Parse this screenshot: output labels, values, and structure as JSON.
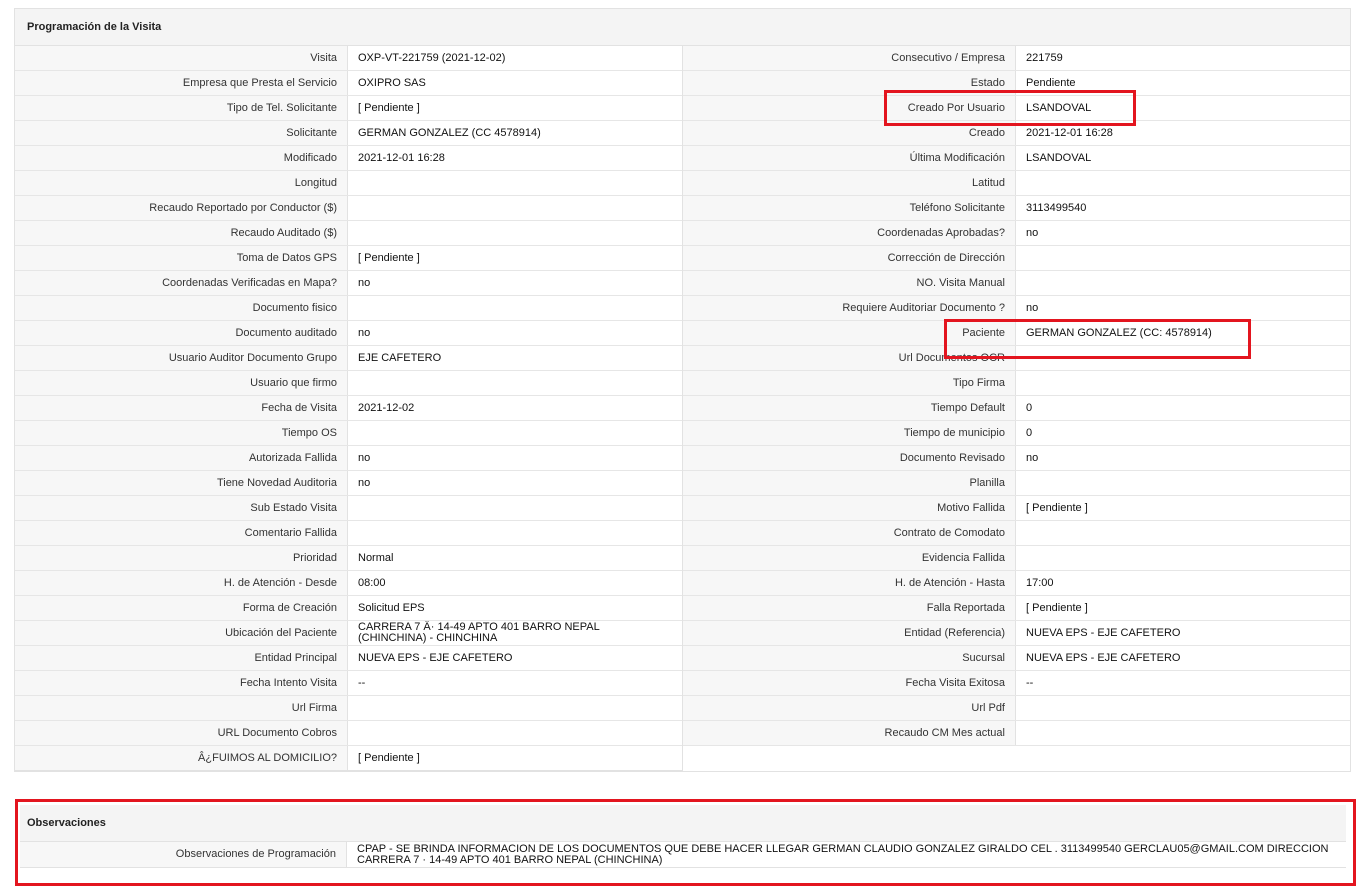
{
  "section_title": "Programación de la Visita",
  "left_rows": [
    {
      "label": "Visita",
      "value": "OXP-VT-221759 (2021-12-02)"
    },
    {
      "label": "Empresa que Presta el Servicio",
      "value": "OXIPRO SAS"
    },
    {
      "label": "Tipo de Tel. Solicitante",
      "value": "[ Pendiente ]"
    },
    {
      "label": "Solicitante",
      "value": "GERMAN GONZALEZ (CC 4578914)"
    },
    {
      "label": "Modificado",
      "value": "2021-12-01 16:28"
    },
    {
      "label": "Longitud",
      "value": ""
    },
    {
      "label": "Recaudo Reportado por Conductor ($)",
      "value": ""
    },
    {
      "label": "Recaudo Auditado ($)",
      "value": ""
    },
    {
      "label": "Toma de Datos GPS",
      "value": "[ Pendiente ]"
    },
    {
      "label": "Coordenadas Verificadas en Mapa?",
      "value": " no"
    },
    {
      "label": "Documento fisico",
      "value": ""
    },
    {
      "label": "Documento auditado",
      "value": " no"
    },
    {
      "label": "Usuario Auditor Documento Grupo",
      "value": "EJE CAFETERO"
    },
    {
      "label": "Usuario que firmo",
      "value": ""
    },
    {
      "label": "Fecha de Visita",
      "value": " 2021-12-02"
    },
    {
      "label": "Tiempo OS",
      "value": ""
    },
    {
      "label": "Autorizada Fallida",
      "value": " no"
    },
    {
      "label": "Tiene Novedad Auditoria",
      "value": " no"
    },
    {
      "label": "Sub Estado Visita",
      "value": ""
    },
    {
      "label": "Comentario Fallida",
      "value": ""
    },
    {
      "label": "Prioridad",
      "value": "Normal"
    },
    {
      "label": "H. de Atención - Desde",
      "value": "08:00"
    },
    {
      "label": "Forma de Creación",
      "value": "Solicitud EPS"
    },
    {
      "label": "Ubicación del Paciente",
      "value": "CARRERA 7 Â· 14-49 APTO 401 BARRO NEPAL (CHINCHINA) - CHINCHINA"
    },
    {
      "label": "Entidad Principal",
      "value": "NUEVA EPS - EJE CAFETERO"
    },
    {
      "label": "Fecha Intento Visita",
      "value": " --"
    },
    {
      "label": "Url Firma",
      "value": ""
    },
    {
      "label": "URL Documento Cobros",
      "value": ""
    },
    {
      "label": "Â¿FUIMOS AL DOMICILIO?",
      "value": "[ Pendiente ]"
    }
  ],
  "right_rows": [
    {
      "label": "Consecutivo / Empresa",
      "value": "221759"
    },
    {
      "label": "Estado",
      "value": "Pendiente"
    },
    {
      "label": "Creado Por Usuario",
      "value": "LSANDOVAL"
    },
    {
      "label": "Creado",
      "value": "2021-12-01 16:28"
    },
    {
      "label": "Última Modificación",
      "value": " LSANDOVAL"
    },
    {
      "label": "Latitud",
      "value": ""
    },
    {
      "label": "Teléfono Solicitante",
      "value": "3113499540"
    },
    {
      "label": "Coordenadas Aprobadas?",
      "value": " no"
    },
    {
      "label": "Corrección de Dirección",
      "value": ""
    },
    {
      "label": "NO. Visita Manual",
      "value": ""
    },
    {
      "label": "Requiere Auditoriar Documento ?",
      "value": " no"
    },
    {
      "label": "Paciente",
      "value": "GERMAN GONZALEZ (CC: 4578914)"
    },
    {
      "label": "Url Documentos OCR",
      "value": ""
    },
    {
      "label": "Tipo Firma",
      "value": ""
    },
    {
      "label": "Tiempo Default",
      "value": "0"
    },
    {
      "label": "Tiempo de municipio",
      "value": "0"
    },
    {
      "label": "Documento Revisado",
      "value": " no"
    },
    {
      "label": "Planilla",
      "value": ""
    },
    {
      "label": "Motivo Fallida",
      "value": "[ Pendiente ]"
    },
    {
      "label": "Contrato de Comodato",
      "value": ""
    },
    {
      "label": "Evidencia Fallida",
      "value": ""
    },
    {
      "label": "H. de Atención - Hasta",
      "value": "17:00"
    },
    {
      "label": "Falla Reportada",
      "value": "[ Pendiente ]"
    },
    {
      "label": "Entidad (Referencia)",
      "value": "NUEVA EPS - EJE CAFETERO"
    },
    {
      "label": "Sucursal",
      "value": "NUEVA EPS - EJE CAFETERO"
    },
    {
      "label": "Fecha Visita Exitosa",
      "value": " --"
    },
    {
      "label": "Url Pdf",
      "value": ""
    },
    {
      "label": "Recaudo CM Mes actual",
      "value": ""
    }
  ],
  "observations": {
    "title": "Observaciones",
    "label": "Observaciones de Programación",
    "value": "  CPAP - SE BRINDA INFORMACION DE LOS DOCUMENTOS QUE DEBE HACER LLEGAR GERMAN CLAUDIO GONZALEZ GIRALDO CEL . 3113499540 GERCLAU05@GMAIL.COM DIRECCION CARRERA 7 · 14-49 APTO 401 BARRO NEPAL (CHINCHINA)"
  },
  "highlight_color": "#e3151f"
}
